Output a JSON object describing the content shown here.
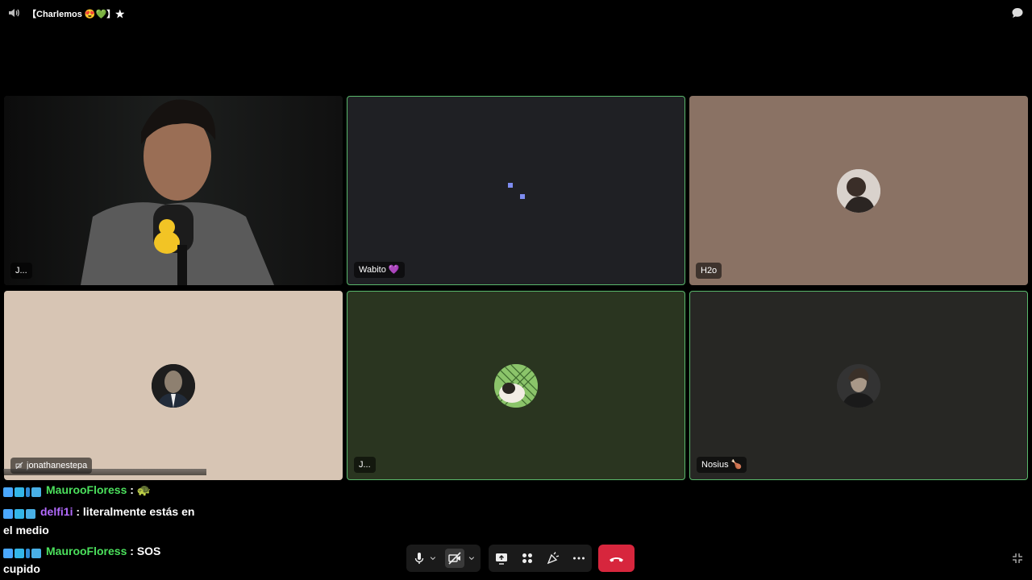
{
  "window": {
    "title": "【Charlemos 😍💚】★",
    "volume_icon": "speaker-icon",
    "chat_icon": "chat-bubble-icon"
  },
  "participants": [
    {
      "name": "J...",
      "type": "video",
      "speaking": false,
      "bg": "#1b1b1b"
    },
    {
      "name": "Wabito 💜",
      "type": "loading",
      "speaking": true,
      "bg": "#1f2024"
    },
    {
      "name": "H2o",
      "type": "avatar",
      "speaking": false,
      "bg": "#8a7264"
    },
    {
      "name": "jonathanestepa",
      "type": "avatar",
      "speaking": false,
      "bg": "#d7c5b4",
      "muted_camera": true
    },
    {
      "name": "J...",
      "type": "avatar",
      "speaking": true,
      "bg": "#2a3520"
    },
    {
      "name": "Nosius 🍗",
      "type": "avatar",
      "speaking": true,
      "bg": "#272724"
    }
  ],
  "chat": [
    {
      "user": "MaurooFloress",
      "color": "#4be05c",
      "message": "🐢",
      "continuation": ""
    },
    {
      "user": "delfi1i",
      "color": "#b36bff",
      "message": "literalmente estás en",
      "continuation": "el medio"
    },
    {
      "user": "MaurooFloress",
      "color": "#4be05c",
      "message": "SOS",
      "continuation": "cupido"
    }
  ],
  "controls": {
    "mic_icon": "microphone-icon",
    "camera_icon": "camera-off-icon",
    "screenshare_icon": "screen-share-icon",
    "activities_icon": "activities-icon",
    "soundboard_icon": "soundboard-icon",
    "more_icon": "more-options-icon",
    "hangup_icon": "hang-up-icon",
    "hangup_color": "#d7263d"
  }
}
